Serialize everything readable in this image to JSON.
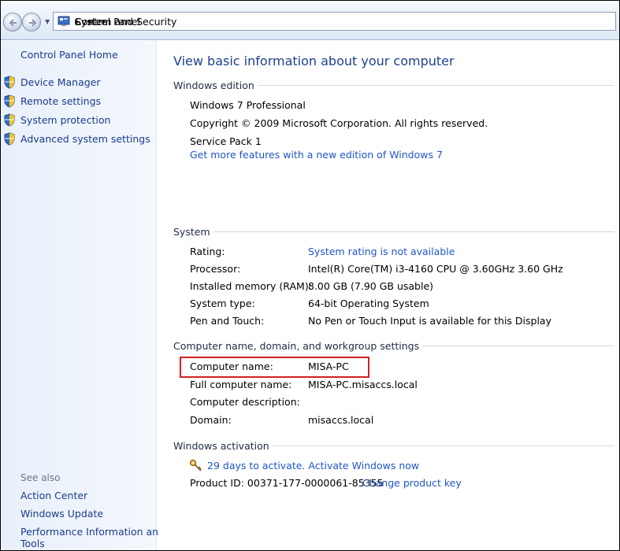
{
  "address_bar": {
    "breadcrumbs": [
      "Control Panel",
      "System and Security",
      "System"
    ]
  },
  "left_pane": {
    "home_label": "Control Panel Home",
    "tasks": [
      {
        "label": "Device Manager",
        "icon": "shield-icon"
      },
      {
        "label": "Remote settings",
        "icon": "shield-icon"
      },
      {
        "label": "System protection",
        "icon": "shield-icon"
      },
      {
        "label": "Advanced system settings",
        "icon": "shield-icon"
      }
    ],
    "see_also_label": "See also",
    "see_also": [
      "Action Center",
      "Windows Update",
      "Performance Information and",
      "Tools"
    ]
  },
  "main": {
    "title": "View basic information about your computer",
    "edition": {
      "heading": "Windows edition",
      "name": "Windows 7 Professional",
      "copyright": "Copyright © 2009 Microsoft Corporation.  All rights reserved.",
      "service_pack": "Service Pack 1",
      "more_features_link": "Get more features with a new edition of Windows 7"
    },
    "system": {
      "heading": "System",
      "rows": [
        {
          "label": "Rating:",
          "value": "System rating is not available"
        },
        {
          "label": "Processor:",
          "value": "Intel(R) Core(TM) i3-4160 CPU @ 3.60GHz   3.60 GHz"
        },
        {
          "label": "Installed memory (RAM):",
          "value": "8.00 GB (7.90 GB usable)"
        },
        {
          "label": "System type:",
          "value": "64-bit Operating System"
        },
        {
          "label": "Pen and Touch:",
          "value": "No Pen or Touch Input is available for this Display"
        }
      ]
    },
    "computer_name": {
      "heading": "Computer name, domain, and workgroup settings",
      "rows": [
        {
          "label": "Computer name:",
          "value": "MISA-PC"
        },
        {
          "label": "Full computer name:",
          "value": "MISA-PC.misaccs.local"
        },
        {
          "label": "Computer description:",
          "value": ""
        },
        {
          "label": "Domain:",
          "value": "misaccs.local"
        }
      ]
    },
    "activation": {
      "heading": "Windows activation",
      "status_link": "29 days to activate. Activate Windows now",
      "product_id": "Product ID: 00371-177-0000061-85355",
      "change_key_link": "Change product key"
    }
  },
  "colors": {
    "link": "#1f56c6",
    "title": "#1e3f90",
    "highlight_border": "#d32020",
    "left_pane_bg": "#e9f0fa"
  }
}
